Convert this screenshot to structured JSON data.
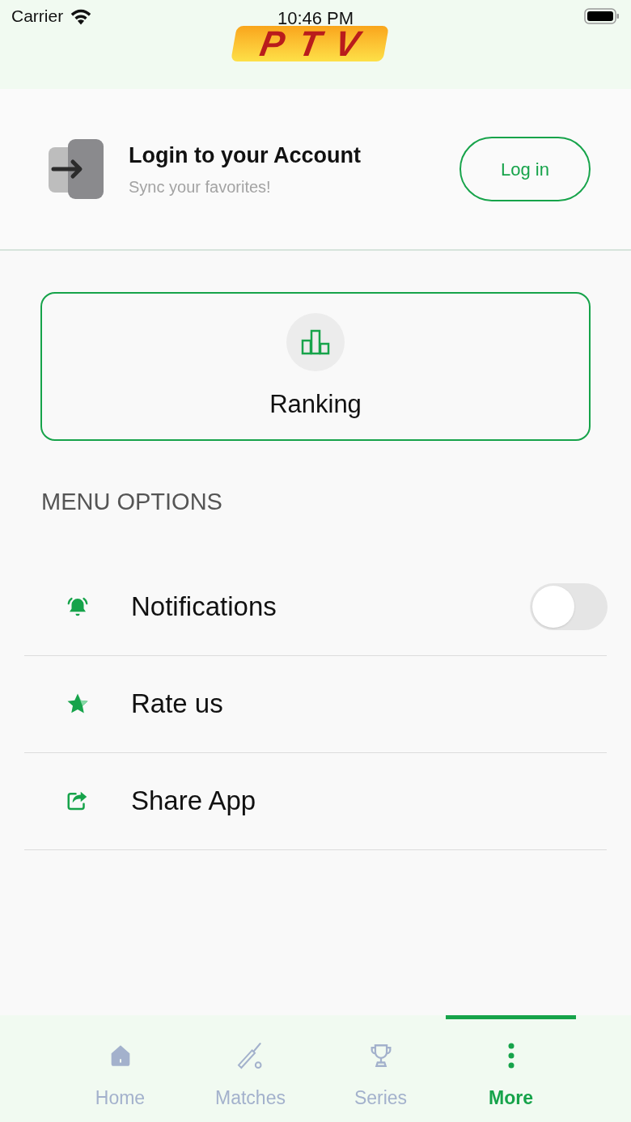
{
  "status_bar": {
    "carrier": "Carrier",
    "time": "10:46 PM"
  },
  "logo": "PTV",
  "login": {
    "title": "Login to your Account",
    "subtitle": "Sync your favorites!",
    "button": "Log in"
  },
  "ranking": {
    "label": "Ranking"
  },
  "menu": {
    "title": "MENU OPTIONS",
    "items": [
      {
        "kind": "toggle",
        "label": "Notifications",
        "on": false
      },
      {
        "kind": "link",
        "label": "Rate us"
      },
      {
        "kind": "link",
        "label": "Share App"
      }
    ]
  },
  "tabs": [
    {
      "label": "Home",
      "selected": false
    },
    {
      "label": "Matches",
      "selected": false
    },
    {
      "label": "Series",
      "selected": false
    },
    {
      "label": "More",
      "selected": true
    }
  ]
}
